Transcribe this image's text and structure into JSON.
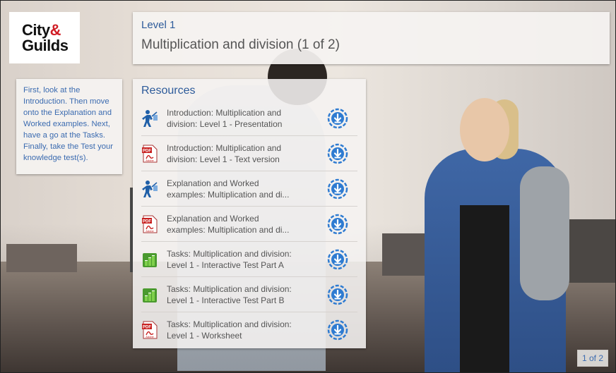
{
  "logo": {
    "line1": "City",
    "amp": "&",
    "line2": "Guilds"
  },
  "header": {
    "level": "Level 1",
    "title": "Multiplication and division (1 of 2)"
  },
  "instructions": {
    "text": "First, look at the Introduction. Then move onto the Explanation and Worked examples. Next, have a go at the Tasks. Finally, take the Test your knowledge test(s)."
  },
  "resources": {
    "heading": "Resources",
    "items": [
      {
        "type": "presentation",
        "line1": "Introduction: Multiplication and",
        "line2": "division: Level 1 - Presentation"
      },
      {
        "type": "pdf",
        "line1": "Introduction: Multiplication and",
        "line2": "division: Level 1 - Text version"
      },
      {
        "type": "presentation",
        "line1": "Explanation and Worked",
        "line2": "examples: Multiplication and di..."
      },
      {
        "type": "pdf",
        "line1": "Explanation and Worked",
        "line2": "examples: Multiplication and di..."
      },
      {
        "type": "interactive",
        "line1": "Tasks: Multiplication and division:",
        "line2": "Level 1 - Interactive Test Part A"
      },
      {
        "type": "interactive",
        "line1": "Tasks: Multiplication and division:",
        "line2": "Level 1 - Interactive Test Part B"
      },
      {
        "type": "pdf",
        "line1": "Tasks: Multiplication and division:",
        "line2": "Level 1 - Worksheet"
      }
    ]
  },
  "pager": {
    "label": "1 of 2"
  },
  "colors": {
    "brand_red": "#d01c24",
    "accent_blue": "#2d5b9a"
  }
}
